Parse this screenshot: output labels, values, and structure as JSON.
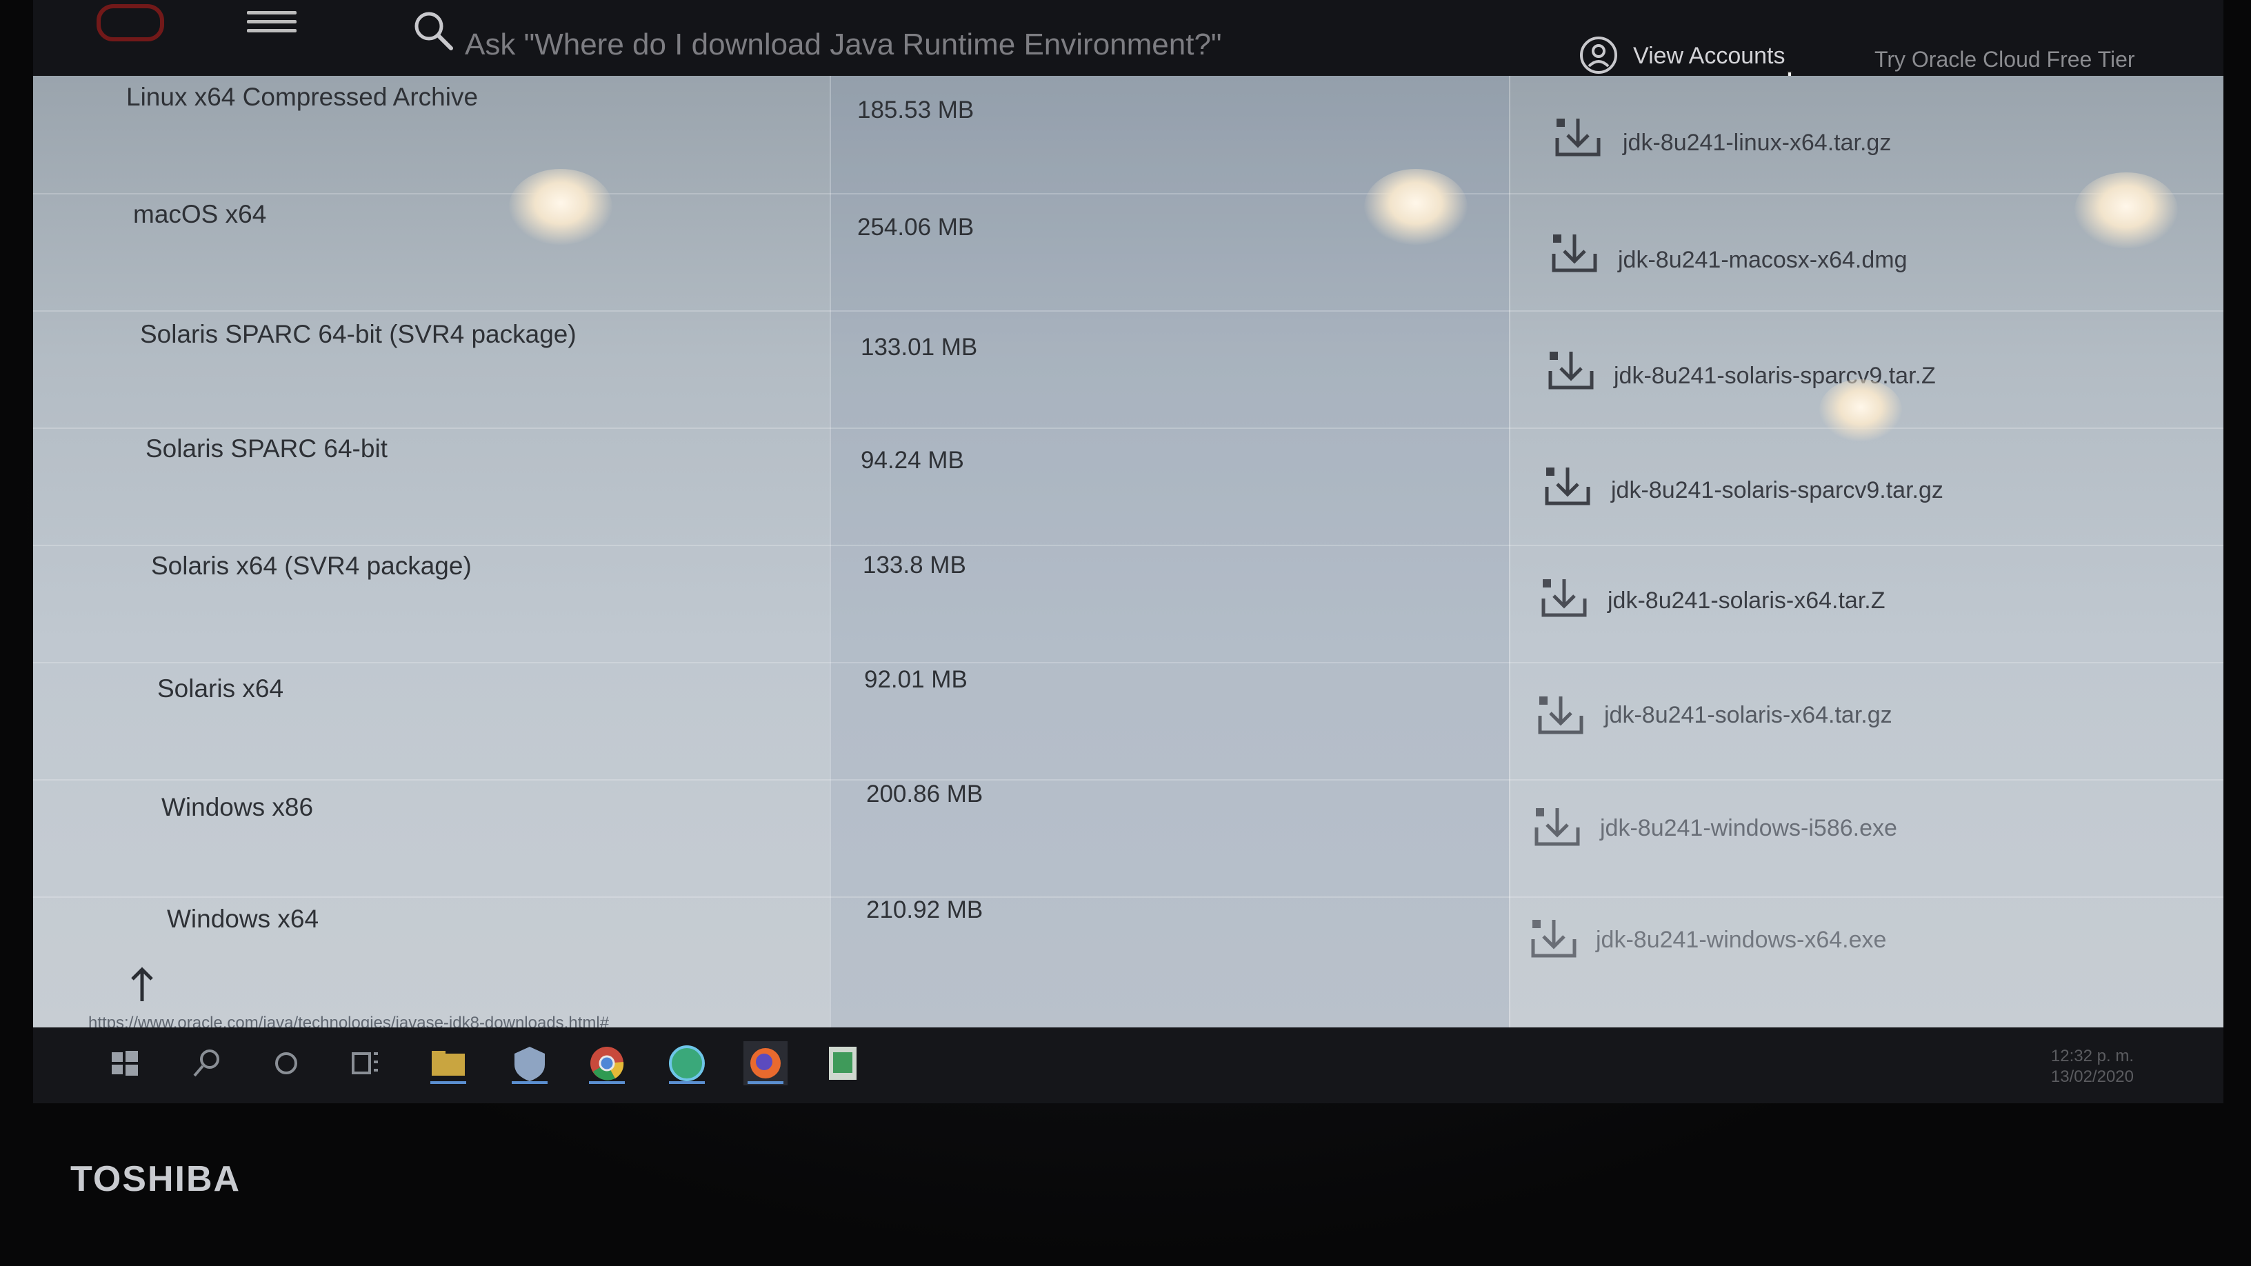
{
  "header": {
    "search_placeholder": "Ask \"Where do I download Java Runtime Environment?\"",
    "view_accounts": "View Accounts",
    "try_oracle": "Try Oracle Cloud Free Tier"
  },
  "downloads": [
    {
      "name": "Linux x64 Compressed Archive",
      "size": "185.53 MB",
      "file": "jdk-8u241-linux-x64.tar.gz"
    },
    {
      "name": "macOS x64",
      "size": "254.06 MB",
      "file": "jdk-8u241-macosx-x64.dmg"
    },
    {
      "name": "Solaris SPARC 64-bit (SVR4 package)",
      "size": "133.01 MB",
      "file": "jdk-8u241-solaris-sparcv9.tar.Z"
    },
    {
      "name": "Solaris SPARC 64-bit",
      "size": "94.24 MB",
      "file": "jdk-8u241-solaris-sparcv9.tar.gz"
    },
    {
      "name": "Solaris x64 (SVR4 package)",
      "size": "133.8 MB",
      "file": "jdk-8u241-solaris-x64.tar.Z"
    },
    {
      "name": "Solaris x64",
      "size": "92.01 MB",
      "file": "jdk-8u241-solaris-x64.tar.gz"
    },
    {
      "name": "Windows x86",
      "size": "200.86 MB",
      "file": "jdk-8u241-windows-i586.exe"
    },
    {
      "name": "Windows x64",
      "size": "210.92 MB",
      "file": "jdk-8u241-windows-x64.exe"
    }
  ],
  "status_url": "https://www.oracle.com/java/technologies/javase-jdk8-downloads.html#",
  "taskbar": {
    "apps": [
      "start-icon",
      "search-icon",
      "cortana-icon",
      "task-view-icon",
      "file-explorer-icon",
      "shield-app-icon",
      "chrome-icon",
      "globe-app-icon",
      "firefox-icon",
      "spreadsheet-app-icon"
    ],
    "clock_time": "12:32 p. m.",
    "clock_date": "13/02/2020"
  },
  "device": {
    "brand": "TOSHIBA"
  },
  "colors": {
    "accent_link": "#3a3d44",
    "brand_red": "#8b1a1a"
  }
}
